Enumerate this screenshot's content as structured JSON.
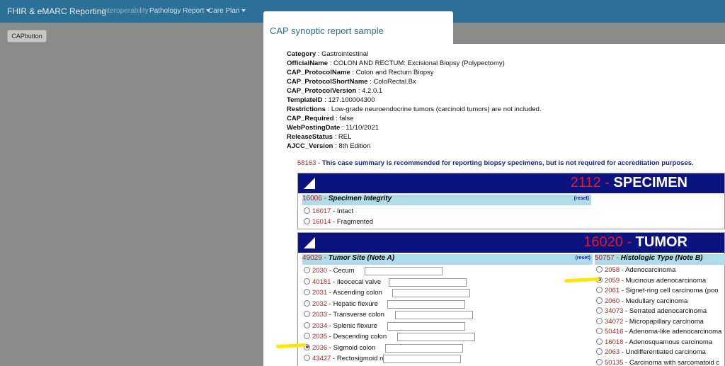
{
  "navbar": {
    "brand": "FHIR & eMARC Reporting",
    "links": [
      "Interoperability",
      "Pathology Report",
      "Care Plan"
    ]
  },
  "page": {
    "cap_button": "CAPbutton"
  },
  "modal": {
    "title": "CAP synoptic report sample",
    "meta": [
      {
        "k": "Category",
        "v": "Gastrointestinal"
      },
      {
        "k": "OfficialName",
        "v": "COLON AND RECTUM: Excisional Biopsy (Polypectomy)"
      },
      {
        "k": "CAP_ProtocolName",
        "v": "Colon and Rectum Biopsy"
      },
      {
        "k": "CAP_ProtocolShortName",
        "v": "ColoRectal.Bx"
      },
      {
        "k": "CAP_ProtocolVersion",
        "v": "4.2.0.1"
      },
      {
        "k": "TemplateID",
        "v": "127.100004300"
      },
      {
        "k": "Restrictions",
        "v": "Low-grade neuroendocrine tumors (carcinoid tumors) are not included."
      },
      {
        "k": "CAP_Required",
        "v": "false"
      },
      {
        "k": "WebPostingDate",
        "v": "11/10/2021"
      },
      {
        "k": "ReleaseStatus",
        "v": "REL"
      },
      {
        "k": "AJCC_Version",
        "v": "8th Edition"
      }
    ],
    "note": {
      "code": "58163",
      "text": "This case summary is recommended for reporting biopsy specimens, but is not required for accreditation purposes."
    },
    "specimen": {
      "code": "2112",
      "title": "SPECIMEN",
      "question": {
        "code": "16006",
        "label": "Specimen Integrity",
        "reset": "(reset)"
      },
      "options": [
        {
          "code": "16017",
          "label": "Intact"
        },
        {
          "code": "16014",
          "label": "Fragmented"
        }
      ]
    },
    "tumor": {
      "code": "16020",
      "title": "TUMOR",
      "site": {
        "code": "49029",
        "label": "Tumor Site (Note A)",
        "reset": "(reset)",
        "options": [
          {
            "code": "2030",
            "label": "Cecum",
            "checked": false
          },
          {
            "code": "40181",
            "label": "Ileocecal valve",
            "checked": false
          },
          {
            "code": "2031",
            "label": "Ascending colon",
            "checked": false
          },
          {
            "code": "2032",
            "label": "Hepatic flexure",
            "checked": false
          },
          {
            "code": "2033",
            "label": "Transverse colon",
            "checked": false
          },
          {
            "code": "2034",
            "label": "Splenic flexure",
            "checked": false
          },
          {
            "code": "2035",
            "label": "Descending colon",
            "checked": false
          },
          {
            "code": "2036",
            "label": "Sigmoid colon",
            "checked": true
          },
          {
            "code": "43427",
            "label": "Rectosigmoid region",
            "checked": false
          }
        ]
      },
      "histo": {
        "code": "50757",
        "label": "Histologic Type (Note B)",
        "options": [
          {
            "code": "2058",
            "label": "Adenocarcinoma",
            "checked": false
          },
          {
            "code": "2059",
            "label": "Mucinous adenocarcinoma",
            "checked": true
          },
          {
            "code": "2061",
            "label": "Signet-ring cell carcinoma (poo",
            "checked": false
          },
          {
            "code": "2060",
            "label": "Medullary carcinoma",
            "checked": false
          },
          {
            "code": "34073",
            "label": "Serrated adenocarcinoma",
            "checked": false
          },
          {
            "code": "34072",
            "label": "Micropapillary carcinoma",
            "checked": false
          },
          {
            "code": "50416",
            "label": "Adenoma-like adenocarcinoma",
            "checked": false
          },
          {
            "code": "16018",
            "label": "Adenosquamous carcinoma",
            "checked": false
          },
          {
            "code": "2063",
            "label": "Undifferentiated carcinoma",
            "checked": false
          },
          {
            "code": "50135",
            "label": "Carcinoma with sarcomatoid c",
            "checked": false
          }
        ]
      }
    }
  },
  "colors": {
    "highlight": "#ffe70a",
    "header_bg": "#0b1380",
    "code_red": "#e21b2c"
  }
}
